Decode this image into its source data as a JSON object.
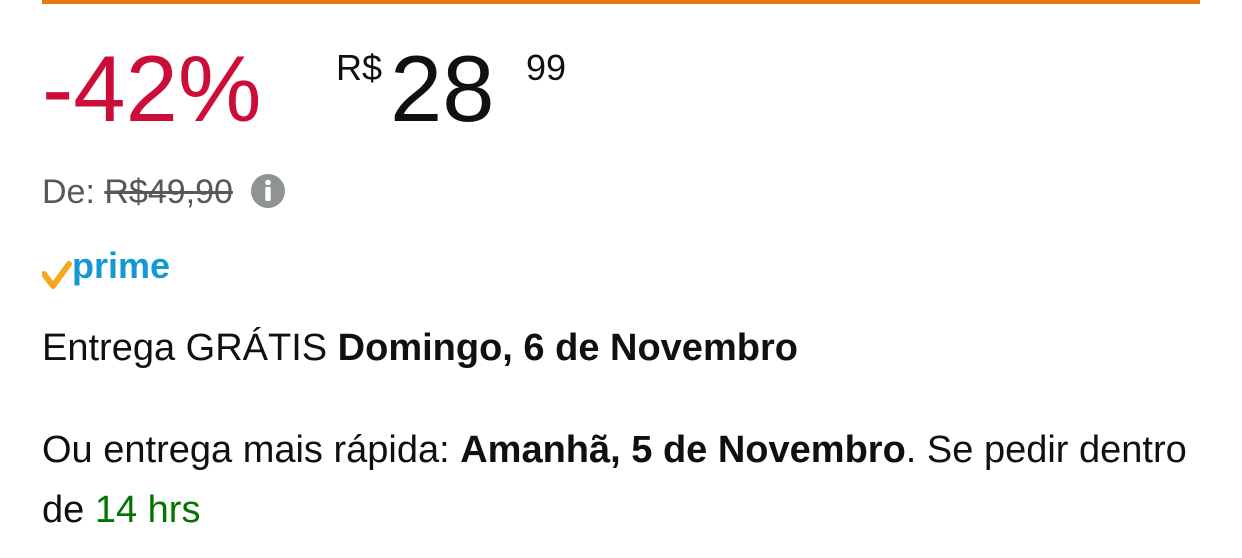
{
  "price": {
    "discount": "-42%",
    "currency_symbol": "R$",
    "whole": "28",
    "fraction": "99"
  },
  "list_price": {
    "label": "De: ",
    "value": "R$49,90"
  },
  "prime": {
    "text": "prime",
    "check_color": "#f8a81b",
    "text_color": "#1399d1"
  },
  "delivery": {
    "prefix": "Entrega GRÁTIS ",
    "date": "Domingo, 6 de Novembro"
  },
  "fast_delivery": {
    "prefix": "Ou entrega mais rápida: ",
    "date": "Amanhã, 5 de Novembro",
    "middle": ". Se pedir dentro de ",
    "countdown": "14 hrs"
  },
  "colors": {
    "accent_bar": "#e47911",
    "discount": "#cc0c39",
    "countdown": "#007600",
    "muted": "#565959"
  }
}
